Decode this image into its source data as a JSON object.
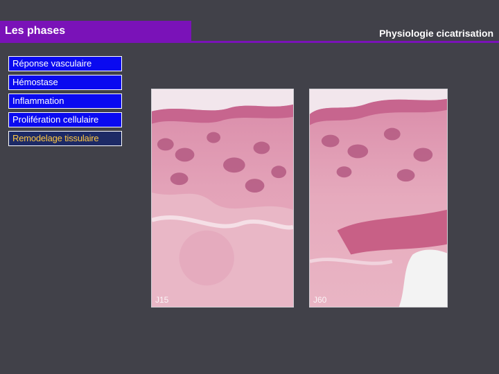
{
  "header": {
    "title": "Les phases",
    "subtitle": "Physiologie cicatrisation",
    "accent_color": "#7a12b8"
  },
  "phases": [
    {
      "label": "Réponse vasculaire",
      "active": false
    },
    {
      "label": "Hémostase",
      "active": false
    },
    {
      "label": "Inflammation",
      "active": false
    },
    {
      "label": "Prolifération cellulaire",
      "active": false
    },
    {
      "label": "Remodelage tissulaire",
      "active": true
    }
  ],
  "images": [
    {
      "label": "J15"
    },
    {
      "label": "J60"
    }
  ]
}
